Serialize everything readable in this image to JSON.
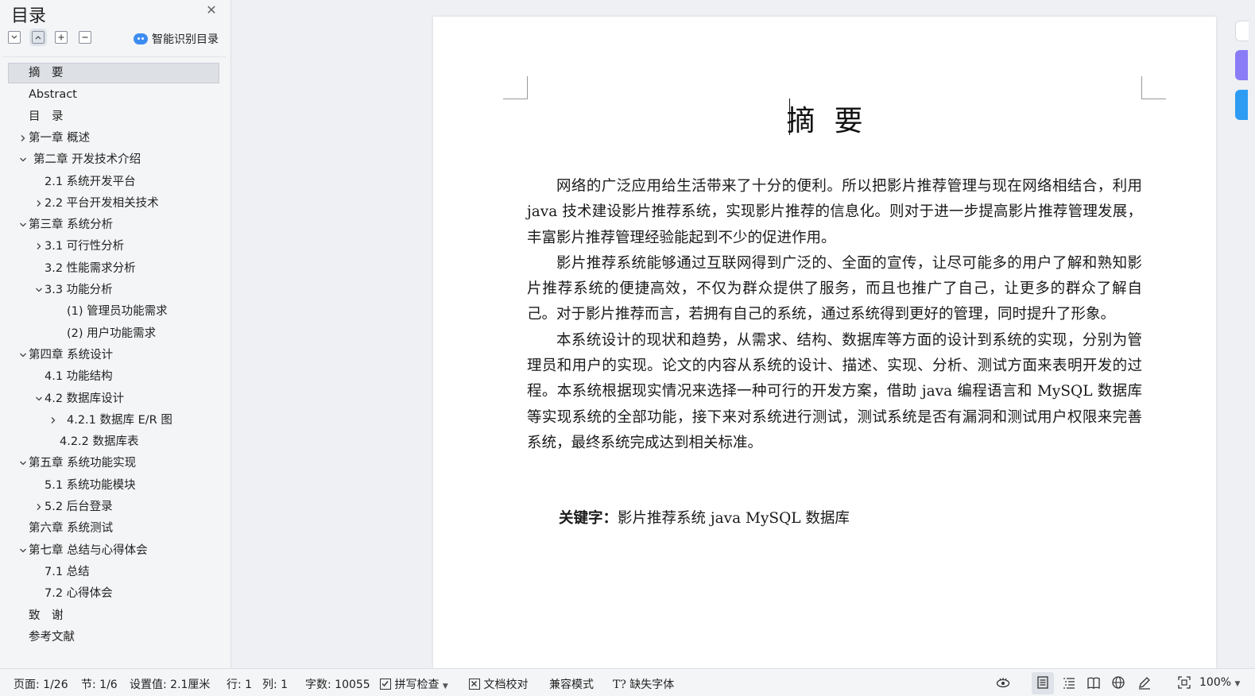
{
  "toc": {
    "title": "目录",
    "smart_toc_label": "智能识别目录",
    "items": [
      {
        "label": "摘　要",
        "level": 0,
        "chevron": "none",
        "selected": true
      },
      {
        "label": "Abstract",
        "level": 0,
        "chevron": "none"
      },
      {
        "label": "目　录",
        "level": 0,
        "chevron": "none"
      },
      {
        "label": "第一章  概述",
        "level": 0,
        "chevron": "right"
      },
      {
        "label": "第二章  开发技术介绍",
        "level": 0,
        "chevron": "down"
      },
      {
        "label": "2.1  系统开发平台",
        "level": 1,
        "chevron": "none"
      },
      {
        "label": "2.2  平台开发相关技术",
        "level": 1,
        "chevron": "right"
      },
      {
        "label": "第三章  系统分析",
        "level": 0,
        "chevron": "down"
      },
      {
        "label": "3.1  可行性分析",
        "level": 1,
        "chevron": "right"
      },
      {
        "label": "3.2 性能需求分析",
        "level": 1,
        "chevron": "none"
      },
      {
        "label": "3.3 功能分析",
        "level": 1,
        "chevron": "down"
      },
      {
        "label": "(1)  管理员功能需求",
        "level": 2,
        "chevron": "none"
      },
      {
        "label": "(2)  用户功能需求",
        "level": 2,
        "chevron": "none"
      },
      {
        "label": "第四章  系统设计",
        "level": 0,
        "chevron": "down"
      },
      {
        "label": "4.1 功能结构",
        "level": 1,
        "chevron": "none"
      },
      {
        "label": "4.2  数据库设计",
        "level": 1,
        "chevron": "down"
      },
      {
        "label": "4.2.1  数据库 E/R 图",
        "level": 2,
        "chevron": "right"
      },
      {
        "label": "4.2.2  数据库表",
        "level": 2,
        "chevron": "none",
        "indent_alt": true
      },
      {
        "label": "第五章  系统功能实现",
        "level": 0,
        "chevron": "down"
      },
      {
        "label": "5.1 系统功能模块",
        "level": 1,
        "chevron": "none"
      },
      {
        "label": "5.2 后台登录",
        "level": 1,
        "chevron": "right"
      },
      {
        "label": "第六章  系统测试",
        "level": 0,
        "chevron": "none"
      },
      {
        "label": "第七章  总结与心得体会",
        "level": 0,
        "chevron": "down"
      },
      {
        "label": "7.1  总结",
        "level": 1,
        "chevron": "none"
      },
      {
        "label": "7.2  心得体会",
        "level": 1,
        "chevron": "none"
      },
      {
        "label": "致　谢",
        "level": 0,
        "chevron": "none"
      },
      {
        "label": "参考文献",
        "level": 0,
        "chevron": "none"
      }
    ]
  },
  "document": {
    "title": "摘要",
    "paragraphs": [
      "网络的广泛应用给生活带来了十分的便利。所以把影片推荐管理与现在网络相结合，利用 java 技术建设影片推荐系统，实现影片推荐的信息化。则对于进一步提高影片推荐管理发展，丰富影片推荐管理经验能起到不少的促进作用。",
      "影片推荐系统能够通过互联网得到广泛的、全面的宣传，让尽可能多的用户了解和熟知影片推荐系统的便捷高效，不仅为群众提供了服务，而且也推广了自己，让更多的群众了解自己。对于影片推荐而言，若拥有自己的系统，通过系统得到更好的管理，同时提升了形象。",
      "本系统设计的现状和趋势，从需求、结构、数据库等方面的设计到系统的实现，分别为管理员和用户的实现。论文的内容从系统的设计、描述、实现、分析、测试方面来表明开发的过程。本系统根据现实情况来选择一种可行的开发方案，借助 java 编程语言和 MySQL 数据库等实现系统的全部功能，接下来对系统进行测试，测试系统是否有漏洞和测试用户权限来完善系统，最终系统完成达到相关标准。"
    ],
    "keywords_label": "关键字：",
    "keywords_value": "影片推荐系统  java   MySQL 数据库"
  },
  "status": {
    "page": "页面: 1/26",
    "section": "节: 1/6",
    "setting": "设置值: 2.1厘米",
    "row": "行: 1",
    "col": "列: 1",
    "word_count": "字数: 10055",
    "spell_check": "拼写检查",
    "proofread": "文档校对",
    "compat_mode": "兼容模式",
    "missing_fonts": "缺失字体",
    "zoom": "100%"
  }
}
